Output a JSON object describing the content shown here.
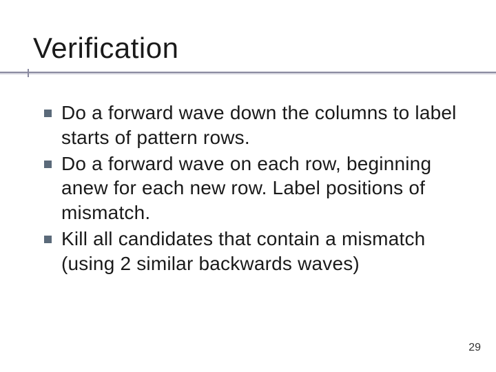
{
  "slide": {
    "title": "Verification",
    "bullets": [
      "Do a forward wave down the columns to label starts of pattern rows.",
      "Do a forward wave on each row, beginning anew for each new row. Label positions of mismatch.",
      "Kill all candidates that contain a mismatch (using 2 similar backwards waves)"
    ],
    "page_number": "29"
  }
}
